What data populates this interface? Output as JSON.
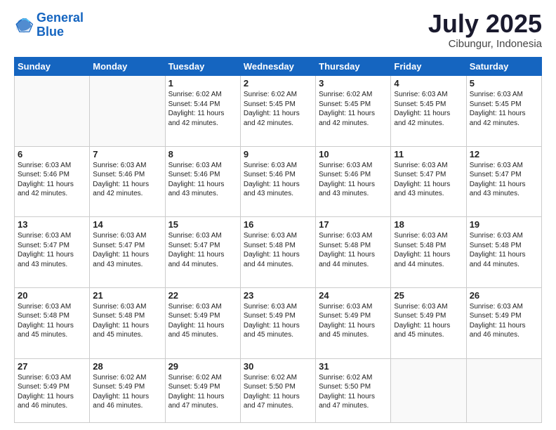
{
  "logo": {
    "line1": "General",
    "line2": "Blue"
  },
  "title": "July 2025",
  "subtitle": "Cibungur, Indonesia",
  "days_of_week": [
    "Sunday",
    "Monday",
    "Tuesday",
    "Wednesday",
    "Thursday",
    "Friday",
    "Saturday"
  ],
  "weeks": [
    [
      {
        "day": "",
        "info": ""
      },
      {
        "day": "",
        "info": ""
      },
      {
        "day": "1",
        "info": "Sunrise: 6:02 AM\nSunset: 5:44 PM\nDaylight: 11 hours and 42 minutes."
      },
      {
        "day": "2",
        "info": "Sunrise: 6:02 AM\nSunset: 5:45 PM\nDaylight: 11 hours and 42 minutes."
      },
      {
        "day": "3",
        "info": "Sunrise: 6:02 AM\nSunset: 5:45 PM\nDaylight: 11 hours and 42 minutes."
      },
      {
        "day": "4",
        "info": "Sunrise: 6:03 AM\nSunset: 5:45 PM\nDaylight: 11 hours and 42 minutes."
      },
      {
        "day": "5",
        "info": "Sunrise: 6:03 AM\nSunset: 5:45 PM\nDaylight: 11 hours and 42 minutes."
      }
    ],
    [
      {
        "day": "6",
        "info": "Sunrise: 6:03 AM\nSunset: 5:46 PM\nDaylight: 11 hours and 42 minutes."
      },
      {
        "day": "7",
        "info": "Sunrise: 6:03 AM\nSunset: 5:46 PM\nDaylight: 11 hours and 42 minutes."
      },
      {
        "day": "8",
        "info": "Sunrise: 6:03 AM\nSunset: 5:46 PM\nDaylight: 11 hours and 43 minutes."
      },
      {
        "day": "9",
        "info": "Sunrise: 6:03 AM\nSunset: 5:46 PM\nDaylight: 11 hours and 43 minutes."
      },
      {
        "day": "10",
        "info": "Sunrise: 6:03 AM\nSunset: 5:46 PM\nDaylight: 11 hours and 43 minutes."
      },
      {
        "day": "11",
        "info": "Sunrise: 6:03 AM\nSunset: 5:47 PM\nDaylight: 11 hours and 43 minutes."
      },
      {
        "day": "12",
        "info": "Sunrise: 6:03 AM\nSunset: 5:47 PM\nDaylight: 11 hours and 43 minutes."
      }
    ],
    [
      {
        "day": "13",
        "info": "Sunrise: 6:03 AM\nSunset: 5:47 PM\nDaylight: 11 hours and 43 minutes."
      },
      {
        "day": "14",
        "info": "Sunrise: 6:03 AM\nSunset: 5:47 PM\nDaylight: 11 hours and 43 minutes."
      },
      {
        "day": "15",
        "info": "Sunrise: 6:03 AM\nSunset: 5:47 PM\nDaylight: 11 hours and 44 minutes."
      },
      {
        "day": "16",
        "info": "Sunrise: 6:03 AM\nSunset: 5:48 PM\nDaylight: 11 hours and 44 minutes."
      },
      {
        "day": "17",
        "info": "Sunrise: 6:03 AM\nSunset: 5:48 PM\nDaylight: 11 hours and 44 minutes."
      },
      {
        "day": "18",
        "info": "Sunrise: 6:03 AM\nSunset: 5:48 PM\nDaylight: 11 hours and 44 minutes."
      },
      {
        "day": "19",
        "info": "Sunrise: 6:03 AM\nSunset: 5:48 PM\nDaylight: 11 hours and 44 minutes."
      }
    ],
    [
      {
        "day": "20",
        "info": "Sunrise: 6:03 AM\nSunset: 5:48 PM\nDaylight: 11 hours and 45 minutes."
      },
      {
        "day": "21",
        "info": "Sunrise: 6:03 AM\nSunset: 5:48 PM\nDaylight: 11 hours and 45 minutes."
      },
      {
        "day": "22",
        "info": "Sunrise: 6:03 AM\nSunset: 5:49 PM\nDaylight: 11 hours and 45 minutes."
      },
      {
        "day": "23",
        "info": "Sunrise: 6:03 AM\nSunset: 5:49 PM\nDaylight: 11 hours and 45 minutes."
      },
      {
        "day": "24",
        "info": "Sunrise: 6:03 AM\nSunset: 5:49 PM\nDaylight: 11 hours and 45 minutes."
      },
      {
        "day": "25",
        "info": "Sunrise: 6:03 AM\nSunset: 5:49 PM\nDaylight: 11 hours and 45 minutes."
      },
      {
        "day": "26",
        "info": "Sunrise: 6:03 AM\nSunset: 5:49 PM\nDaylight: 11 hours and 46 minutes."
      }
    ],
    [
      {
        "day": "27",
        "info": "Sunrise: 6:03 AM\nSunset: 5:49 PM\nDaylight: 11 hours and 46 minutes."
      },
      {
        "day": "28",
        "info": "Sunrise: 6:02 AM\nSunset: 5:49 PM\nDaylight: 11 hours and 46 minutes."
      },
      {
        "day": "29",
        "info": "Sunrise: 6:02 AM\nSunset: 5:49 PM\nDaylight: 11 hours and 47 minutes."
      },
      {
        "day": "30",
        "info": "Sunrise: 6:02 AM\nSunset: 5:50 PM\nDaylight: 11 hours and 47 minutes."
      },
      {
        "day": "31",
        "info": "Sunrise: 6:02 AM\nSunset: 5:50 PM\nDaylight: 11 hours and 47 minutes."
      },
      {
        "day": "",
        "info": ""
      },
      {
        "day": "",
        "info": ""
      }
    ]
  ]
}
